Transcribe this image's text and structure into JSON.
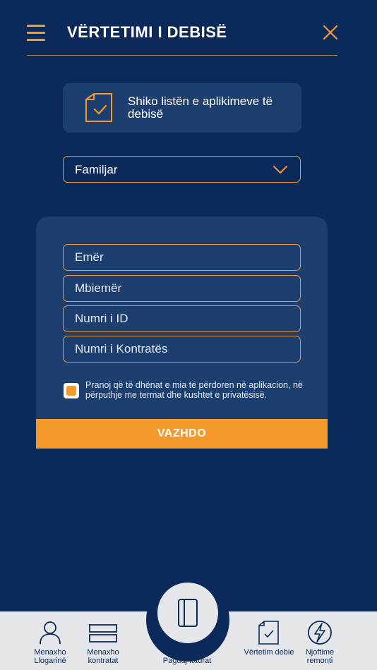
{
  "header": {
    "title": "VËRTETIMI I DEBISË"
  },
  "list_card": {
    "label": "Shiko listën e aplikimeve të debisë"
  },
  "type_select": {
    "value": "Familjar"
  },
  "form": {
    "fields": [
      {
        "placeholder": "Emër"
      },
      {
        "placeholder": "Mbiemër"
      },
      {
        "placeholder": "Numri i ID"
      },
      {
        "placeholder": "Numri i Kontratës"
      }
    ],
    "consent_text": "Pranoj që të dhënat e mia të përdoren në aplikacion, në përputhje me termat dhe kushtet e privatësisë.",
    "consent_checked": true,
    "submit_label": "VAZHDO"
  },
  "bottom_nav": {
    "items": [
      {
        "label": "Menaxho Llogarinë",
        "icon": "user-icon"
      },
      {
        "label": "Menaxho kontratat",
        "icon": "contracts-icon"
      },
      {
        "label": "Paguaj faturat",
        "icon": "wallet-icon"
      },
      {
        "label": "Vërtetim debie",
        "icon": "document-check-icon"
      },
      {
        "label": "Njoftime remonti",
        "icon": "lightning-icon"
      }
    ]
  },
  "colors": {
    "background": "#0b2a5a",
    "card": "#1d3f70",
    "accent": "#f39a2b",
    "nav_background": "#e4e6ea"
  }
}
